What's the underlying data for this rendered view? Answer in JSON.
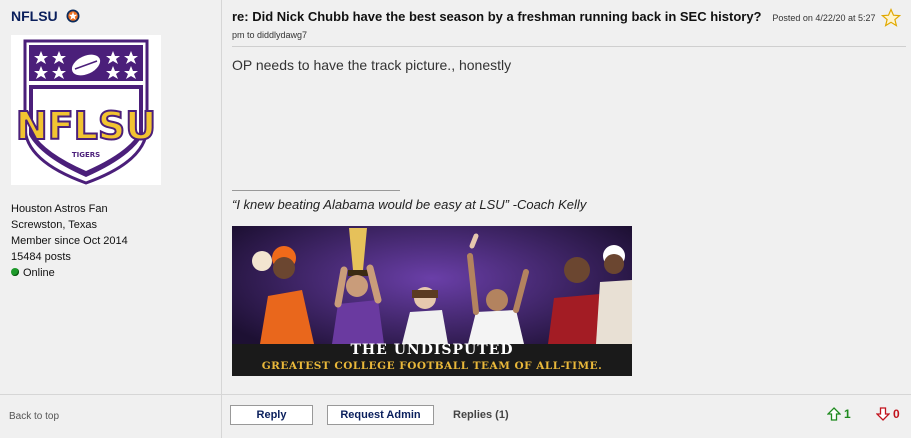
{
  "user": {
    "name": "NFLSU",
    "team_icon": "astros-icon",
    "avatar_icon": "nflsu-shield-logo",
    "avatar_text": "NFLSU",
    "avatar_subtext": "TIGERS",
    "fan_of": "Houston Astros Fan",
    "location": "Screwston, Texas",
    "member_since": "Member since Oct 2014",
    "posts": "15484 posts",
    "status": "Online"
  },
  "sidebar": {
    "back_to_top": "Back to top"
  },
  "post": {
    "subject": "re: Did Nick Chubb have the best season by a freshman running back in SEC history?",
    "posted_on": "Posted on 4/22/20 at 5:27 pm to diddlydawg7",
    "body": "OP needs to have the track picture., honestly",
    "signature_quote": "“I knew beating Alabama would be easy at LSU” -Coach Kelly",
    "signature_banner": {
      "line1": "THE UNDISPUTED",
      "line2": "GREATEST COLLEGE FOOTBALL TEAM OF ALL-TIME."
    }
  },
  "actions": {
    "reply": "Reply",
    "request_admin": "Request Admin",
    "replies": "Replies (1)",
    "upvotes": "1",
    "downvotes": "0"
  },
  "colors": {
    "lsu_purple": "#4b1f7a",
    "lsu_gold": "#f2c431",
    "upvote_green": "#1e8a1e",
    "downvote_red": "#c1121c",
    "username_navy": "#0a1f5c"
  }
}
